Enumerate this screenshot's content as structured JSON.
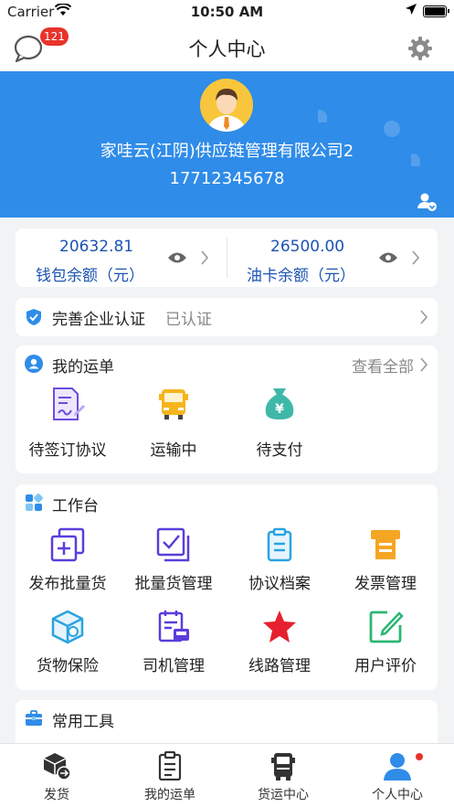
{
  "status_bar": {
    "carrier": "Carrier",
    "time": "10:50 AM"
  },
  "nav": {
    "title": "个人中心",
    "message_badge": "121"
  },
  "profile": {
    "company": "家哇云(江阴)供应链管理有限公司2",
    "phone": "17712345678"
  },
  "wallet": {
    "balance_amount": "20632.81",
    "balance_label": "钱包余额（元）",
    "fuel_amount": "26500.00",
    "fuel_label": "油卡余额（元）"
  },
  "certification": {
    "label": "完善企业认证",
    "status": "已认证"
  },
  "orders": {
    "title": "我的运单",
    "see_all": "查看全部",
    "items": [
      {
        "label": "待签订协议",
        "icon": "sign-agreement-icon"
      },
      {
        "label": "运输中",
        "icon": "truck-icon"
      },
      {
        "label": "待支付",
        "icon": "money-bag-icon"
      }
    ]
  },
  "workbench": {
    "title": "工作台",
    "items": [
      {
        "label": "发布批量货",
        "icon": "publish-batch-icon"
      },
      {
        "label": "批量货管理",
        "icon": "batch-manage-icon"
      },
      {
        "label": "协议档案",
        "icon": "agreement-archive-icon"
      },
      {
        "label": "发票管理",
        "icon": "invoice-icon"
      },
      {
        "label": "货物保险",
        "icon": "cargo-insurance-icon"
      },
      {
        "label": "司机管理",
        "icon": "driver-manage-icon"
      },
      {
        "label": "线路管理",
        "icon": "route-star-icon"
      },
      {
        "label": "用户评价",
        "icon": "user-review-icon"
      }
    ]
  },
  "tools": {
    "title": "常用工具"
  },
  "tabs": [
    {
      "label": "发货",
      "icon": "ship-goods-icon"
    },
    {
      "label": "我的运单",
      "icon": "waybill-icon"
    },
    {
      "label": "货运中心",
      "icon": "freight-center-icon"
    },
    {
      "label": "个人中心",
      "icon": "person-icon"
    }
  ],
  "colors": {
    "brand_blue": "#2f8ce8",
    "amount_blue": "#1c54b2",
    "badge_red": "#e8332b",
    "purple": "#5b3ddb",
    "orange": "#f5a623",
    "teal": "#3fb8a9"
  }
}
